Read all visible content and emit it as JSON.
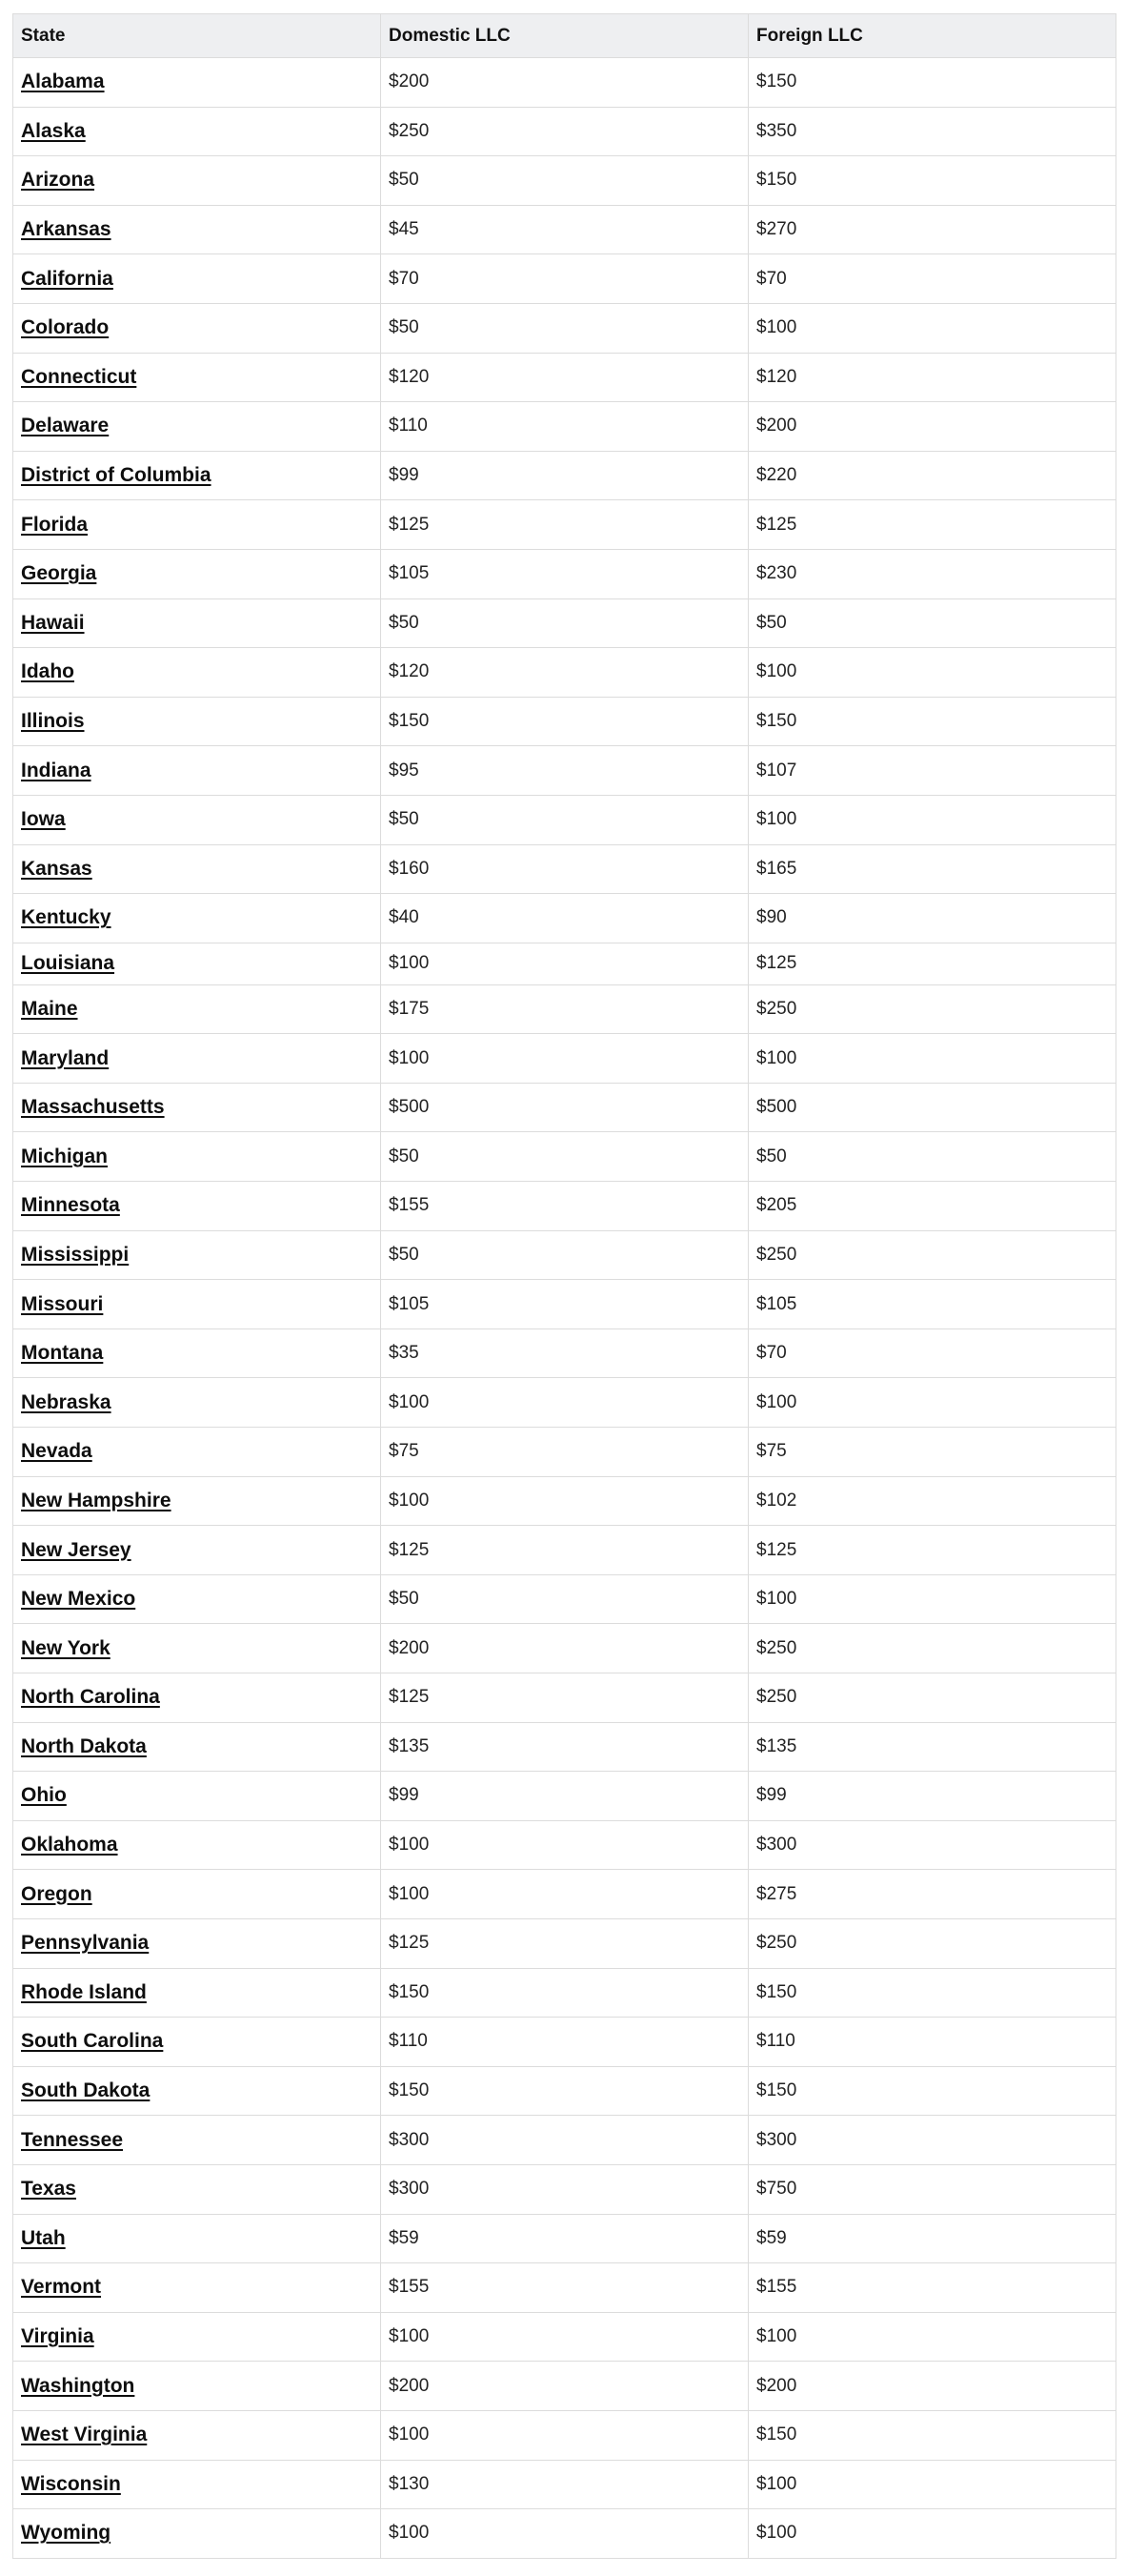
{
  "table": {
    "headers": [
      "State",
      "Domestic LLC",
      "Foreign LLC"
    ],
    "rows": [
      {
        "state": "Alabama",
        "domestic": "$200",
        "foreign": "$150"
      },
      {
        "state": "Alaska",
        "domestic": "$250",
        "foreign": "$350"
      },
      {
        "state": "Arizona",
        "domestic": "$50",
        "foreign": "$150"
      },
      {
        "state": "Arkansas",
        "domestic": "$45",
        "foreign": "$270"
      },
      {
        "state": "California",
        "domestic": "$70",
        "foreign": "$70"
      },
      {
        "state": "Colorado",
        "domestic": "$50",
        "foreign": "$100"
      },
      {
        "state": "Connecticut",
        "domestic": "$120",
        "foreign": "$120"
      },
      {
        "state": "Delaware",
        "domestic": "$110",
        "foreign": "$200"
      },
      {
        "state": "District of Columbia",
        "domestic": "$99",
        "foreign": "$220"
      },
      {
        "state": "Florida",
        "domestic": "$125",
        "foreign": "$125"
      },
      {
        "state": "Georgia",
        "domestic": "$105",
        "foreign": "$230"
      },
      {
        "state": "Hawaii",
        "domestic": "$50",
        "foreign": "$50"
      },
      {
        "state": "Idaho",
        "domestic": "$120",
        "foreign": "$100"
      },
      {
        "state": "Illinois",
        "domestic": "$150",
        "foreign": "$150"
      },
      {
        "state": "Indiana",
        "domestic": "$95",
        "foreign": "$107"
      },
      {
        "state": "Iowa",
        "domestic": "$50",
        "foreign": "$100"
      },
      {
        "state": "Kansas",
        "domestic": "$160",
        "foreign": "$165"
      },
      {
        "state": "Kentucky",
        "domestic": "$40",
        "foreign": "$90"
      },
      {
        "state": "Louisiana",
        "domestic": "$100",
        "foreign": "$125"
      },
      {
        "state": "Maine",
        "domestic": "$175",
        "foreign": "$250"
      },
      {
        "state": "Maryland",
        "domestic": "$100",
        "foreign": "$100"
      },
      {
        "state": "Massachusetts",
        "domestic": "$500",
        "foreign": "$500"
      },
      {
        "state": "Michigan",
        "domestic": "$50",
        "foreign": "$50"
      },
      {
        "state": "Minnesota",
        "domestic": "$155",
        "foreign": "$205"
      },
      {
        "state": "Mississippi",
        "domestic": "$50",
        "foreign": "$250"
      },
      {
        "state": "Missouri",
        "domestic": "$105",
        "foreign": "$105"
      },
      {
        "state": "Montana",
        "domestic": "$35",
        "foreign": "$70"
      },
      {
        "state": "Nebraska",
        "domestic": "$100",
        "foreign": "$100"
      },
      {
        "state": "Nevada",
        "domestic": "$75",
        "foreign": "$75"
      },
      {
        "state": "New Hampshire",
        "domestic": "$100",
        "foreign": "$102"
      },
      {
        "state": "New Jersey",
        "domestic": "$125",
        "foreign": "$125"
      },
      {
        "state": "New Mexico",
        "domestic": "$50",
        "foreign": "$100"
      },
      {
        "state": "New York",
        "domestic": "$200",
        "foreign": "$250"
      },
      {
        "state": "North Carolina",
        "domestic": "$125",
        "foreign": "$250"
      },
      {
        "state": "North Dakota",
        "domestic": "$135",
        "foreign": "$135"
      },
      {
        "state": "Ohio",
        "domestic": "$99",
        "foreign": "$99"
      },
      {
        "state": "Oklahoma",
        "domestic": "$100",
        "foreign": "$300"
      },
      {
        "state": "Oregon",
        "domestic": "$100",
        "foreign": "$275"
      },
      {
        "state": "Pennsylvania",
        "domestic": "$125",
        "foreign": "$250"
      },
      {
        "state": "Rhode Island",
        "domestic": "$150",
        "foreign": "$150"
      },
      {
        "state": "South Carolina",
        "domestic": "$110",
        "foreign": "$110"
      },
      {
        "state": "South Dakota",
        "domestic": "$150",
        "foreign": "$150"
      },
      {
        "state": "Tennessee",
        "domestic": "$300",
        "foreign": "$300"
      },
      {
        "state": "Texas",
        "domestic": "$300",
        "foreign": "$750"
      },
      {
        "state": "Utah",
        "domestic": "$59",
        "foreign": "$59"
      },
      {
        "state": "Vermont",
        "domestic": "$155",
        "foreign": "$155"
      },
      {
        "state": "Virginia",
        "domestic": "$100",
        "foreign": "$100"
      },
      {
        "state": "Washington",
        "domestic": "$200",
        "foreign": "$200"
      },
      {
        "state": "West Virginia",
        "domestic": "$100",
        "foreign": "$150"
      },
      {
        "state": "Wisconsin",
        "domestic": "$130",
        "foreign": "$100"
      },
      {
        "state": "Wyoming",
        "domestic": "$100",
        "foreign": "$100"
      }
    ]
  }
}
